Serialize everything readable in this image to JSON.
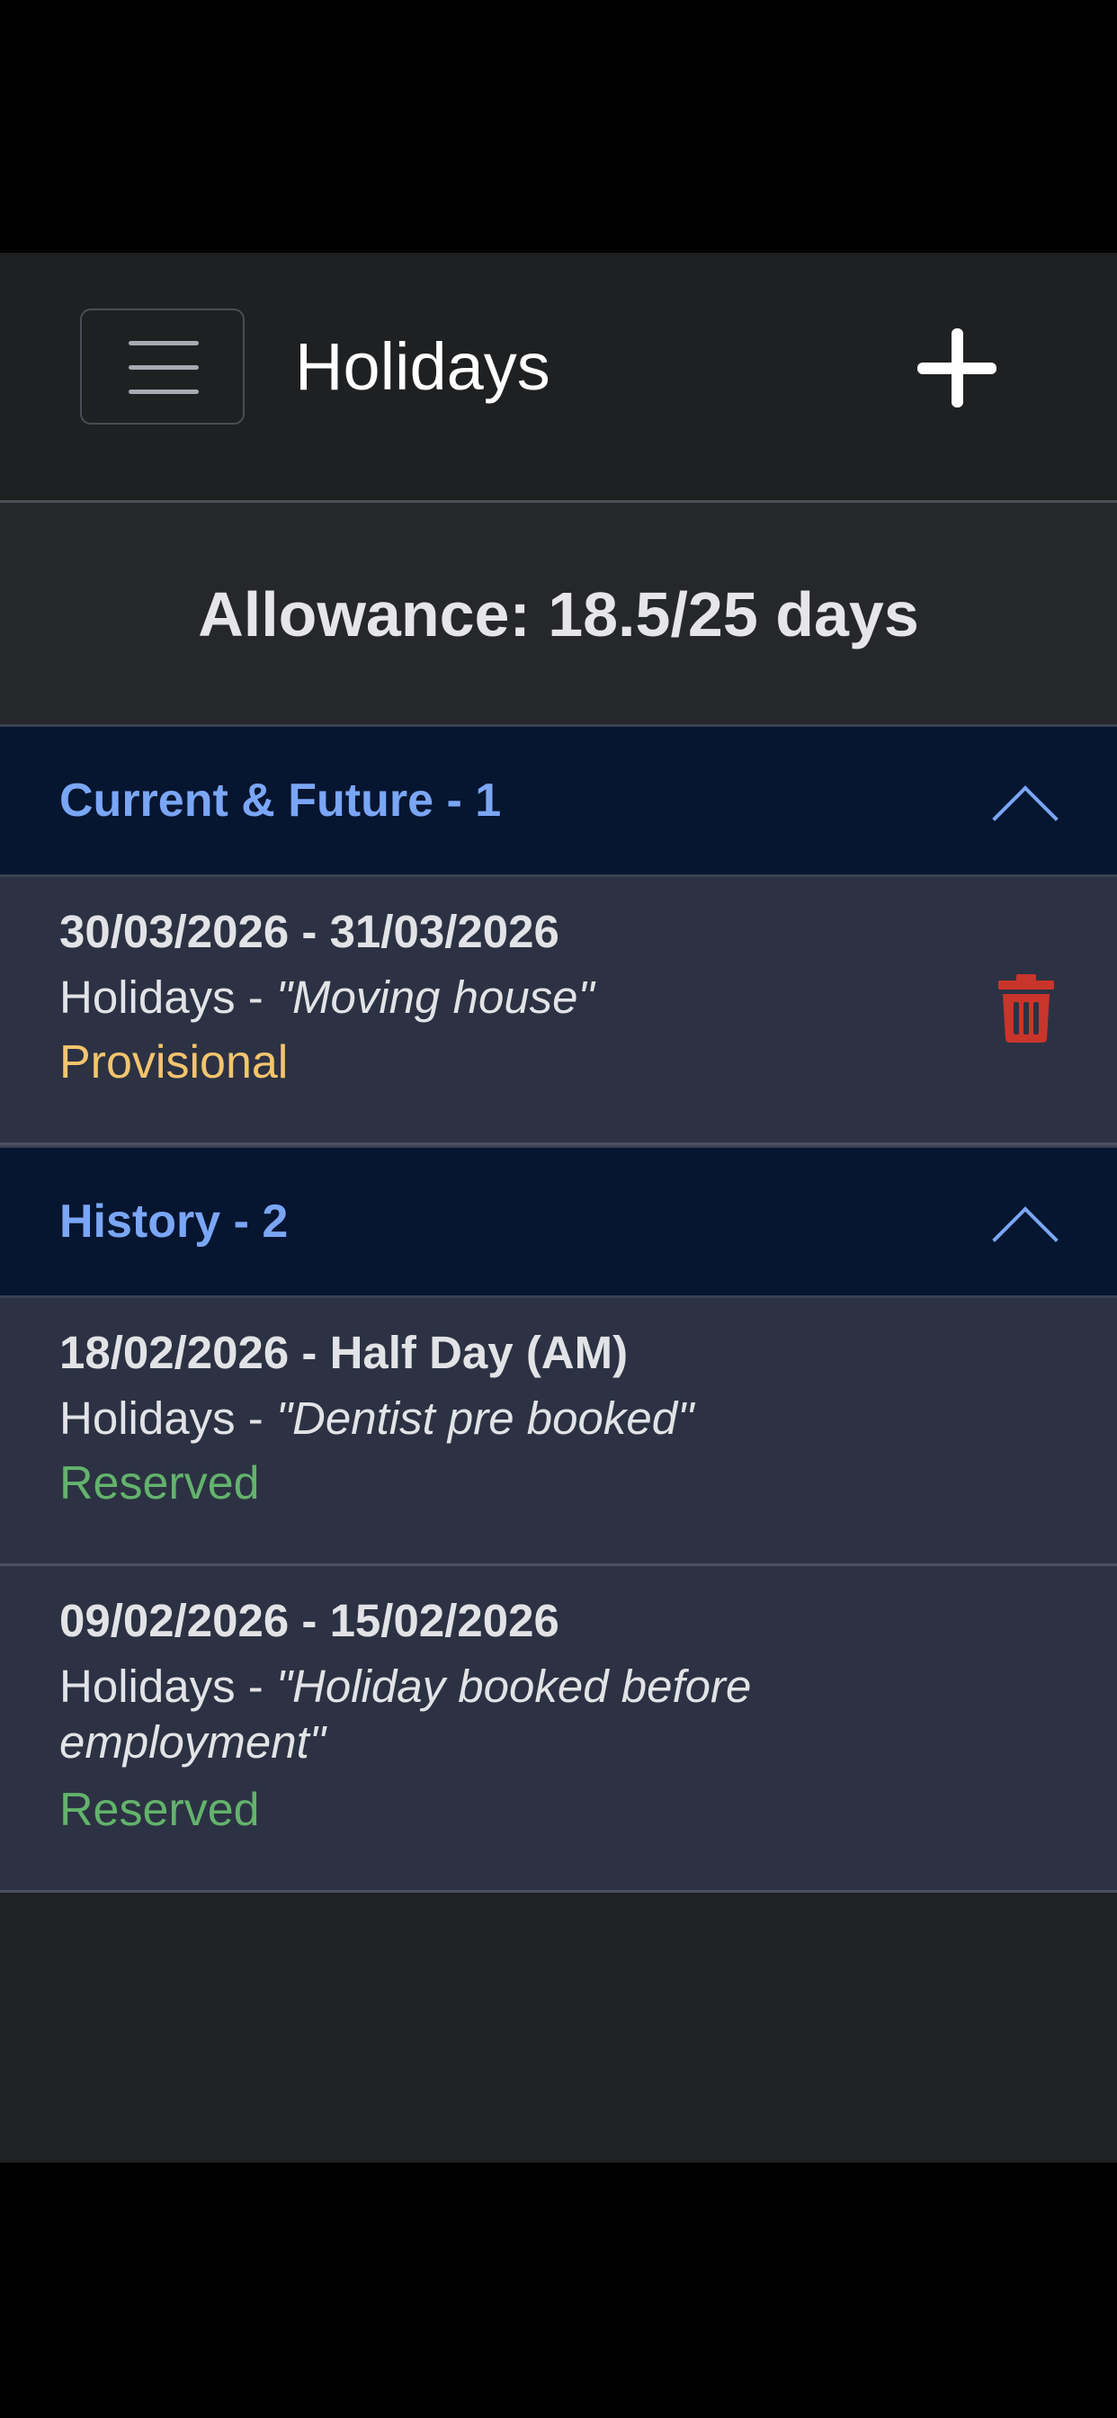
{
  "header": {
    "title": "Holidays",
    "menu_icon": "hamburger-icon",
    "add_icon": "plus-icon"
  },
  "allowance": {
    "text": "Allowance: 18.5/25 days"
  },
  "sections": [
    {
      "title": "Current & Future - 1",
      "chevron_icon": "chevron-up-icon",
      "entries": [
        {
          "dates": "30/03/2026 - 31/03/2026",
          "type_prefix": "Holidays - ",
          "reason": "\"Moving house\"",
          "status": "Provisional",
          "delete_icon": "trash-icon"
        }
      ]
    },
    {
      "title": "History - 2",
      "chevron_icon": "chevron-up-icon",
      "entries": [
        {
          "dates": "18/02/2026 - Half Day (AM)",
          "type_prefix": "Holidays - ",
          "reason": "\"Dentist pre booked\"",
          "status": "Reserved"
        },
        {
          "dates": "09/02/2026 - 15/02/2026",
          "type_prefix": "Holidays - ",
          "reason": "\"Holiday booked before employment\"",
          "status": "Reserved"
        }
      ]
    }
  ],
  "colors": {
    "section_header_bg": "#061530",
    "section_title": "#7aa6f5",
    "entry_bg": "#2c3243",
    "provisional": "#f4c46d",
    "reserved": "#63b36c",
    "delete": "#c9352b"
  }
}
